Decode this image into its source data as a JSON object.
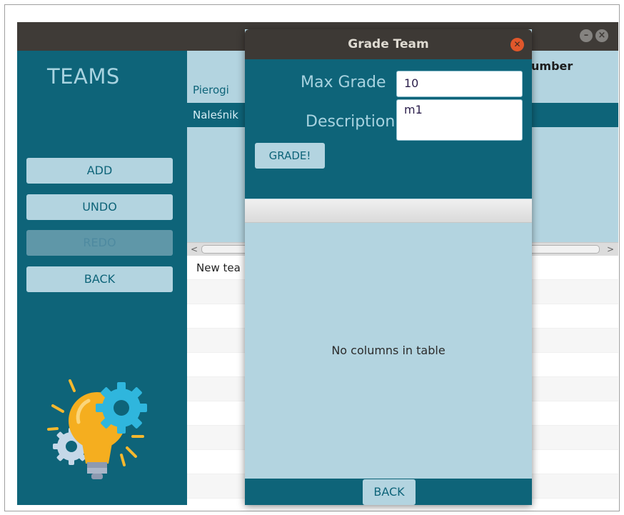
{
  "main": {
    "sidebar": {
      "title": "TEAMS",
      "buttons": {
        "add": "ADD",
        "undo": "UNDO",
        "redo": "REDO",
        "back": "BACK"
      }
    },
    "list": {
      "header": "umber",
      "items": [
        "Pierogi",
        "Naleśnik"
      ],
      "selected_index": 1
    },
    "table": {
      "rows": [
        "New tea"
      ]
    }
  },
  "dialog": {
    "title": "Grade Team",
    "max_grade_label": "Max Grade",
    "max_grade_value": "10",
    "description_label": "Description",
    "description_value": "m1",
    "grade_button": "GRADE!",
    "empty_table_text": "No columns in table",
    "back_button": "BACK"
  },
  "colors": {
    "primary": "#0e6479",
    "light": "#b3d4e0",
    "titlebar": "#3d3935",
    "close": "#e0572b"
  }
}
